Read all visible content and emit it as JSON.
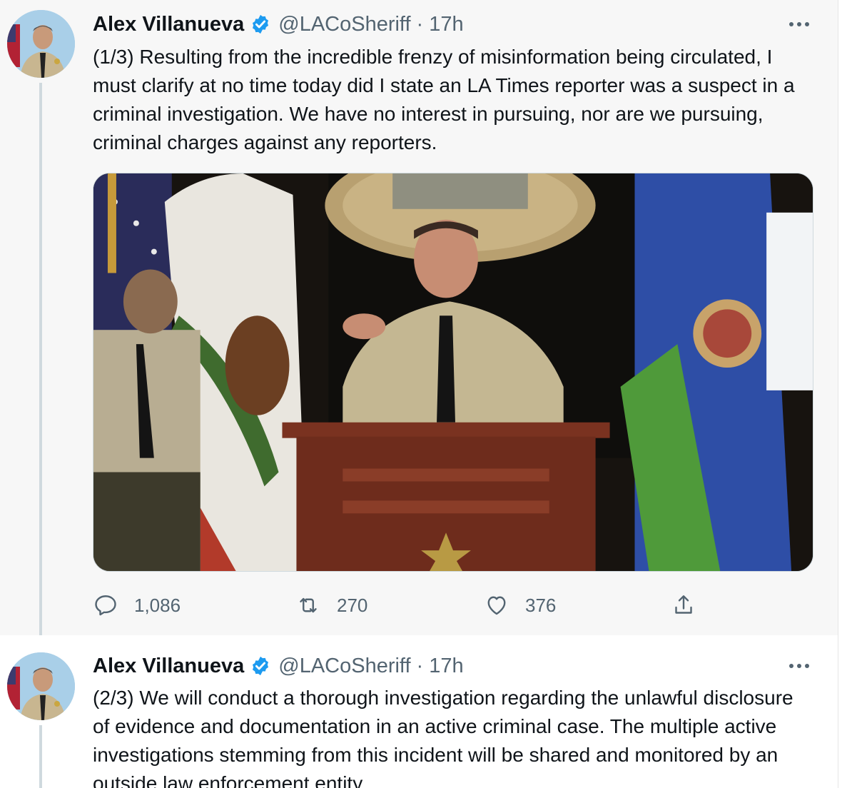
{
  "tweets": [
    {
      "author_name": "Alex Villanueva",
      "handle": "@LACoSheriff",
      "separator": "·",
      "time": "17h",
      "text": "(1/3) Resulting from the incredible frenzy of misinformation being circulated, I must clarify at no time today did I state an LA Times reporter was a suspect in a criminal investigation. We have no interest in pursuing, nor are we pursuing, criminal charges against any reporters.",
      "stats": {
        "replies": "1,086",
        "retweets": "270",
        "likes": "376"
      }
    },
    {
      "author_name": "Alex Villanueva",
      "handle": "@LACoSheriff",
      "separator": "·",
      "time": "17h",
      "text": "(2/3) We will conduct a thorough investigation regarding the unlawful disclosure of evidence and documentation in an active criminal case.  The multiple active investigations stemming from this incident will be shared and monitored by an outside law enforcement entity."
    }
  ],
  "icons": {
    "verified": "verified-badge-icon",
    "more": "more-options-icon",
    "reply": "reply-icon",
    "retweet": "retweet-icon",
    "like": "heart-icon",
    "share": "share-icon"
  },
  "colors": {
    "verified_blue": "#1d9bf0",
    "secondary_text": "#536471",
    "thread_line": "#cfd9de"
  }
}
